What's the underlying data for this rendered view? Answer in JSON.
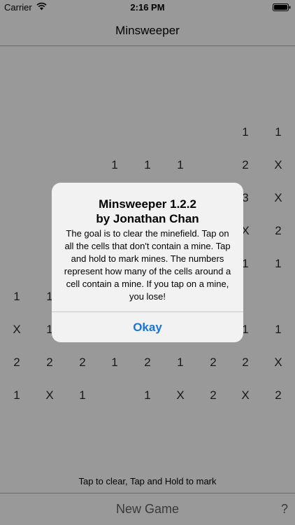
{
  "status_bar": {
    "carrier": "Carrier",
    "time": "2:16 PM"
  },
  "nav": {
    "title": "Minsweeper"
  },
  "grid": {
    "rows": [
      [
        "",
        "",
        "",
        "",
        "",
        "",
        "",
        "1",
        "1"
      ],
      [
        "",
        "",
        "",
        "1",
        "1",
        "1",
        "",
        "2",
        "X"
      ],
      [
        "",
        "",
        "",
        "",
        "",
        "",
        "",
        "3",
        "X"
      ],
      [
        "",
        "",
        "",
        "",
        "",
        "",
        "",
        "X",
        "2"
      ],
      [
        "",
        "",
        "",
        "",
        "",
        "",
        "",
        "1",
        "1"
      ],
      [
        "1",
        "1",
        "",
        "",
        "",
        "",
        "",
        "",
        ""
      ],
      [
        "X",
        "1",
        "",
        "",
        "",
        "",
        "",
        "1",
        "1"
      ],
      [
        "2",
        "2",
        "2",
        "1",
        "2",
        "1",
        "2",
        "2",
        "X"
      ],
      [
        "1",
        "X",
        "1",
        "",
        "1",
        "X",
        "2",
        "X",
        "2"
      ]
    ]
  },
  "footer": {
    "hint": "Tap to clear, Tap and Hold to mark",
    "new_game": "New Game",
    "help": "?"
  },
  "alert": {
    "title_line1": "Minsweeper 1.2.2",
    "title_line2": "by Jonathan Chan",
    "message": "The goal is to clear the minefield. Tap on all the cells that don't contain a mine. Tap and hold to mark mines. The numbers represent how many of the cells around a cell contain a mine. If you tap on a mine, you lose!",
    "button": "Okay"
  },
  "colors": {
    "accent": "#1a73d9",
    "overlay": "rgba(0,0,0,0.4)"
  },
  "icons": [
    "wifi-icon",
    "battery-icon"
  ]
}
